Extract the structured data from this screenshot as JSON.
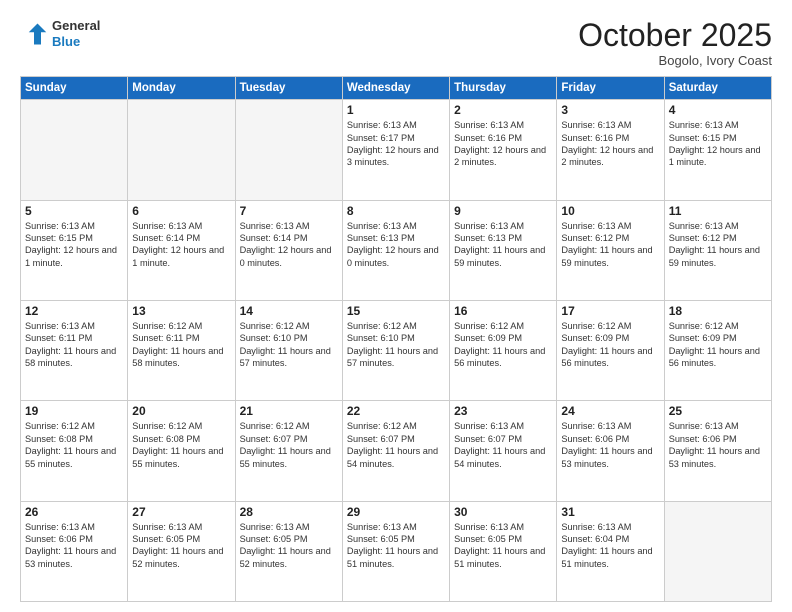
{
  "header": {
    "logo_line1": "General",
    "logo_line2": "Blue",
    "month": "October 2025",
    "location": "Bogolo, Ivory Coast"
  },
  "weekdays": [
    "Sunday",
    "Monday",
    "Tuesday",
    "Wednesday",
    "Thursday",
    "Friday",
    "Saturday"
  ],
  "weeks": [
    [
      {
        "day": "",
        "text": "",
        "empty": true
      },
      {
        "day": "",
        "text": "",
        "empty": true
      },
      {
        "day": "",
        "text": "",
        "empty": true
      },
      {
        "day": "1",
        "text": "Sunrise: 6:13 AM\nSunset: 6:17 PM\nDaylight: 12 hours and 3 minutes.",
        "empty": false
      },
      {
        "day": "2",
        "text": "Sunrise: 6:13 AM\nSunset: 6:16 PM\nDaylight: 12 hours and 2 minutes.",
        "empty": false
      },
      {
        "day": "3",
        "text": "Sunrise: 6:13 AM\nSunset: 6:16 PM\nDaylight: 12 hours and 2 minutes.",
        "empty": false
      },
      {
        "day": "4",
        "text": "Sunrise: 6:13 AM\nSunset: 6:15 PM\nDaylight: 12 hours and 1 minute.",
        "empty": false
      }
    ],
    [
      {
        "day": "5",
        "text": "Sunrise: 6:13 AM\nSunset: 6:15 PM\nDaylight: 12 hours and 1 minute.",
        "empty": false
      },
      {
        "day": "6",
        "text": "Sunrise: 6:13 AM\nSunset: 6:14 PM\nDaylight: 12 hours and 1 minute.",
        "empty": false
      },
      {
        "day": "7",
        "text": "Sunrise: 6:13 AM\nSunset: 6:14 PM\nDaylight: 12 hours and 0 minutes.",
        "empty": false
      },
      {
        "day": "8",
        "text": "Sunrise: 6:13 AM\nSunset: 6:13 PM\nDaylight: 12 hours and 0 minutes.",
        "empty": false
      },
      {
        "day": "9",
        "text": "Sunrise: 6:13 AM\nSunset: 6:13 PM\nDaylight: 11 hours and 59 minutes.",
        "empty": false
      },
      {
        "day": "10",
        "text": "Sunrise: 6:13 AM\nSunset: 6:12 PM\nDaylight: 11 hours and 59 minutes.",
        "empty": false
      },
      {
        "day": "11",
        "text": "Sunrise: 6:13 AM\nSunset: 6:12 PM\nDaylight: 11 hours and 59 minutes.",
        "empty": false
      }
    ],
    [
      {
        "day": "12",
        "text": "Sunrise: 6:13 AM\nSunset: 6:11 PM\nDaylight: 11 hours and 58 minutes.",
        "empty": false
      },
      {
        "day": "13",
        "text": "Sunrise: 6:12 AM\nSunset: 6:11 PM\nDaylight: 11 hours and 58 minutes.",
        "empty": false
      },
      {
        "day": "14",
        "text": "Sunrise: 6:12 AM\nSunset: 6:10 PM\nDaylight: 11 hours and 57 minutes.",
        "empty": false
      },
      {
        "day": "15",
        "text": "Sunrise: 6:12 AM\nSunset: 6:10 PM\nDaylight: 11 hours and 57 minutes.",
        "empty": false
      },
      {
        "day": "16",
        "text": "Sunrise: 6:12 AM\nSunset: 6:09 PM\nDaylight: 11 hours and 56 minutes.",
        "empty": false
      },
      {
        "day": "17",
        "text": "Sunrise: 6:12 AM\nSunset: 6:09 PM\nDaylight: 11 hours and 56 minutes.",
        "empty": false
      },
      {
        "day": "18",
        "text": "Sunrise: 6:12 AM\nSunset: 6:09 PM\nDaylight: 11 hours and 56 minutes.",
        "empty": false
      }
    ],
    [
      {
        "day": "19",
        "text": "Sunrise: 6:12 AM\nSunset: 6:08 PM\nDaylight: 11 hours and 55 minutes.",
        "empty": false
      },
      {
        "day": "20",
        "text": "Sunrise: 6:12 AM\nSunset: 6:08 PM\nDaylight: 11 hours and 55 minutes.",
        "empty": false
      },
      {
        "day": "21",
        "text": "Sunrise: 6:12 AM\nSunset: 6:07 PM\nDaylight: 11 hours and 55 minutes.",
        "empty": false
      },
      {
        "day": "22",
        "text": "Sunrise: 6:12 AM\nSunset: 6:07 PM\nDaylight: 11 hours and 54 minutes.",
        "empty": false
      },
      {
        "day": "23",
        "text": "Sunrise: 6:13 AM\nSunset: 6:07 PM\nDaylight: 11 hours and 54 minutes.",
        "empty": false
      },
      {
        "day": "24",
        "text": "Sunrise: 6:13 AM\nSunset: 6:06 PM\nDaylight: 11 hours and 53 minutes.",
        "empty": false
      },
      {
        "day": "25",
        "text": "Sunrise: 6:13 AM\nSunset: 6:06 PM\nDaylight: 11 hours and 53 minutes.",
        "empty": false
      }
    ],
    [
      {
        "day": "26",
        "text": "Sunrise: 6:13 AM\nSunset: 6:06 PM\nDaylight: 11 hours and 53 minutes.",
        "empty": false
      },
      {
        "day": "27",
        "text": "Sunrise: 6:13 AM\nSunset: 6:05 PM\nDaylight: 11 hours and 52 minutes.",
        "empty": false
      },
      {
        "day": "28",
        "text": "Sunrise: 6:13 AM\nSunset: 6:05 PM\nDaylight: 11 hours and 52 minutes.",
        "empty": false
      },
      {
        "day": "29",
        "text": "Sunrise: 6:13 AM\nSunset: 6:05 PM\nDaylight: 11 hours and 51 minutes.",
        "empty": false
      },
      {
        "day": "30",
        "text": "Sunrise: 6:13 AM\nSunset: 6:05 PM\nDaylight: 11 hours and 51 minutes.",
        "empty": false
      },
      {
        "day": "31",
        "text": "Sunrise: 6:13 AM\nSunset: 6:04 PM\nDaylight: 11 hours and 51 minutes.",
        "empty": false
      },
      {
        "day": "",
        "text": "",
        "empty": true
      }
    ]
  ]
}
